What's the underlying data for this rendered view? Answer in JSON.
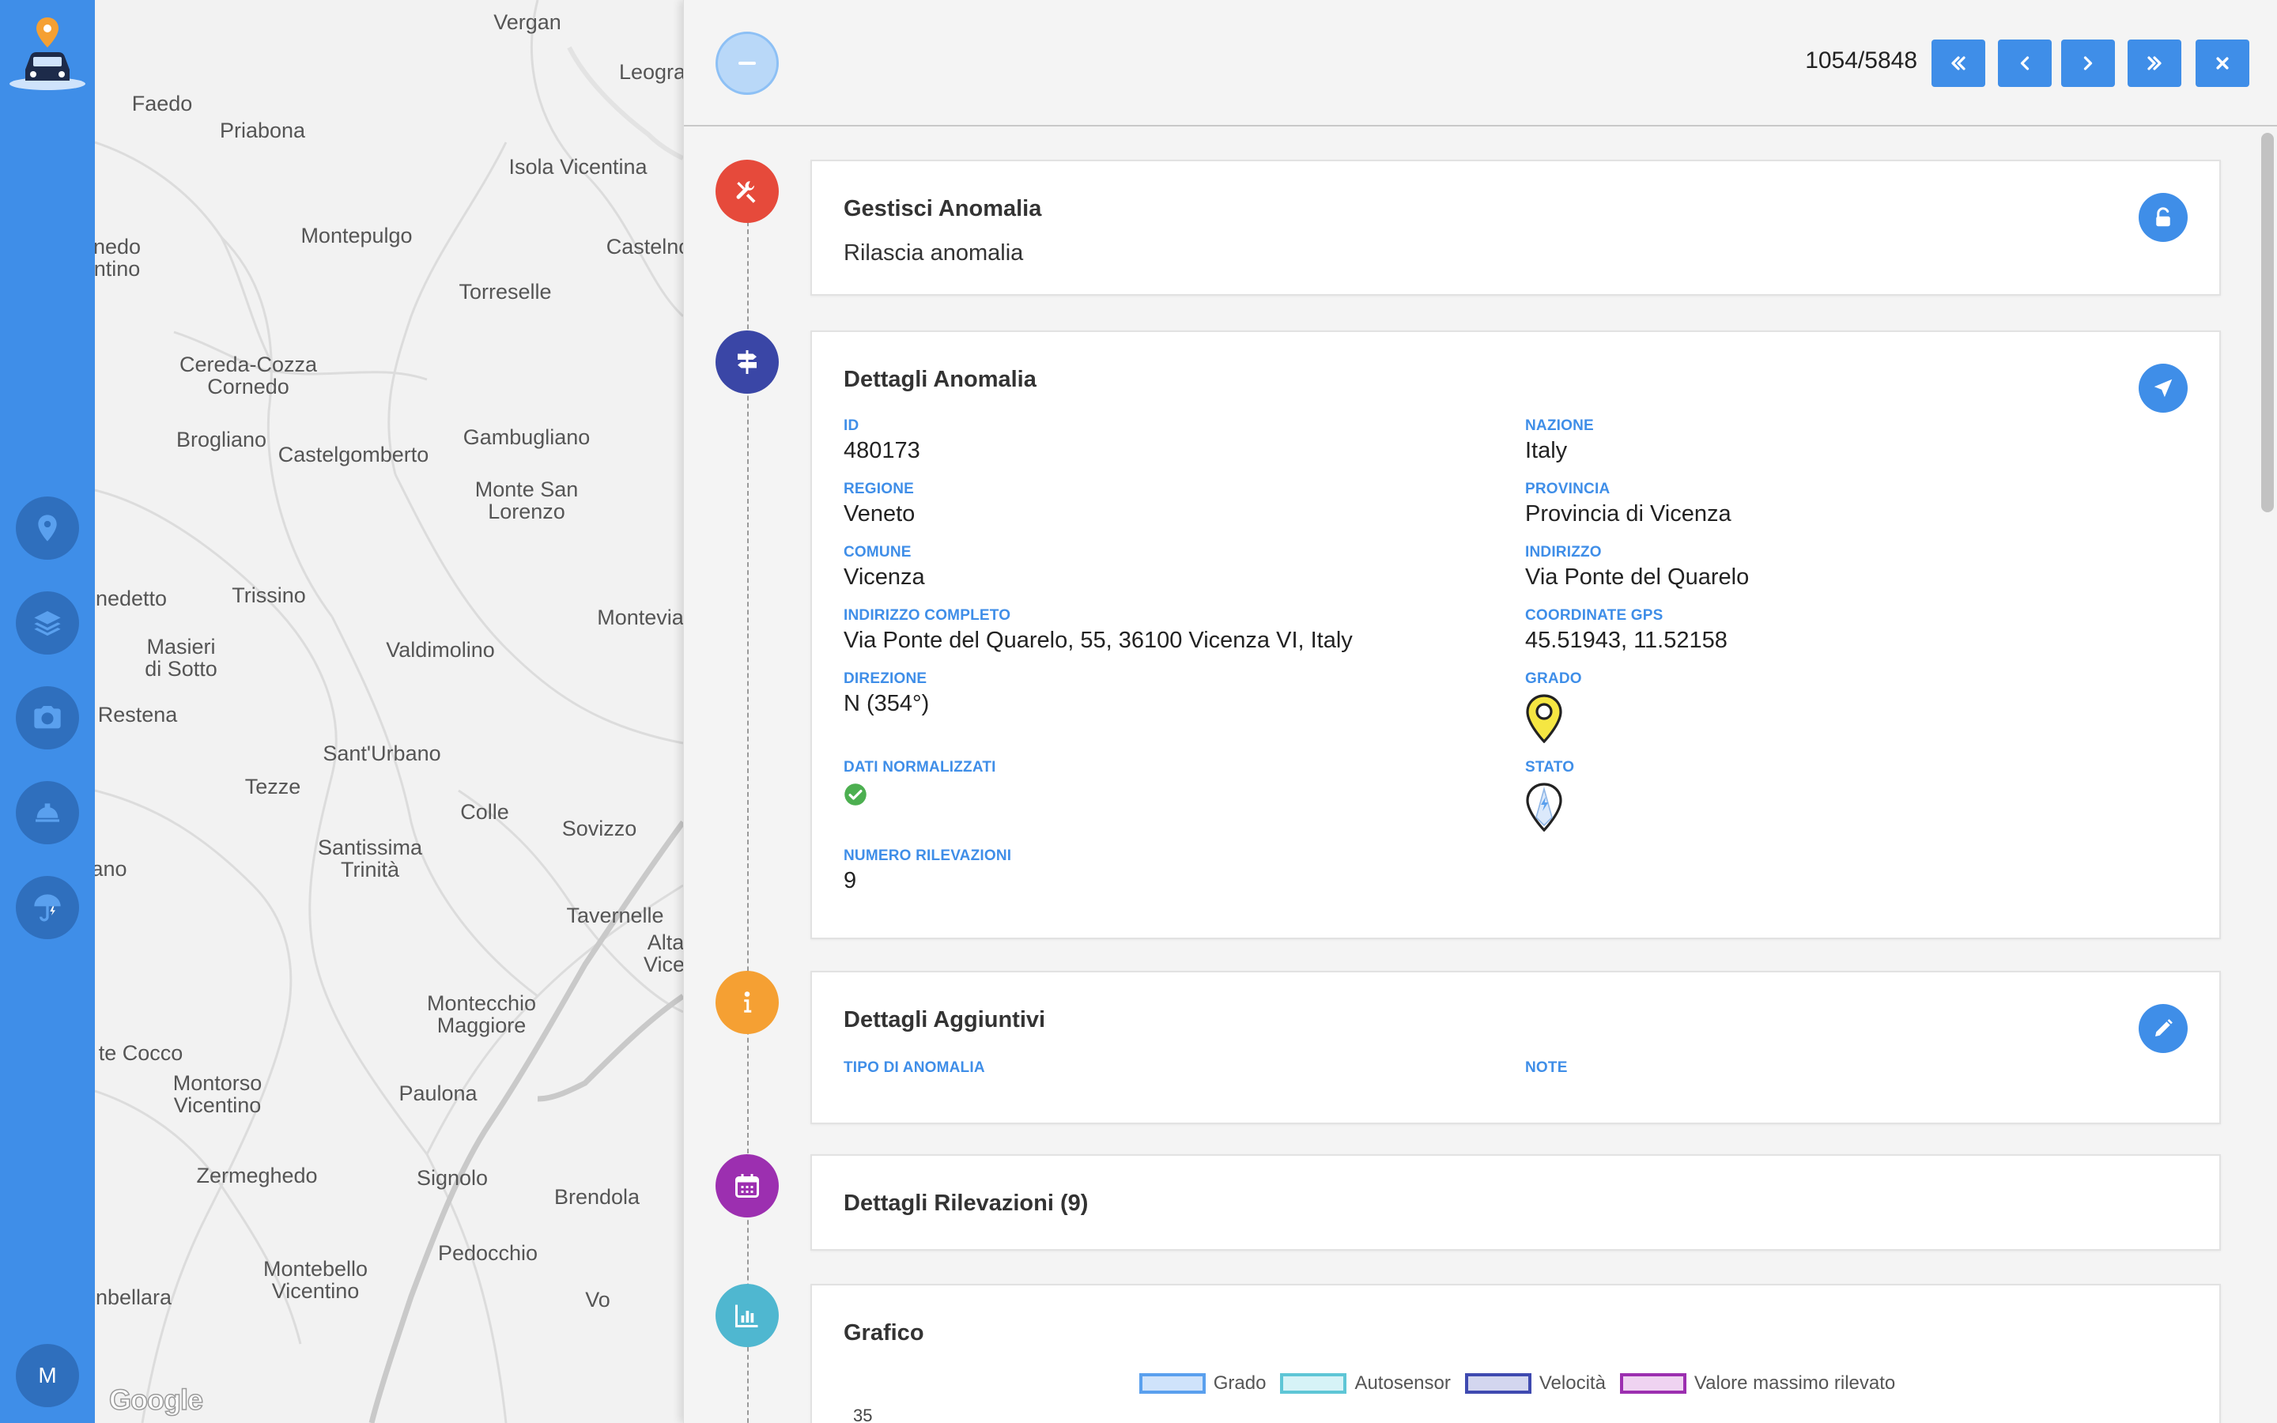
{
  "sidebar": {
    "nav": [
      {
        "name": "map-pin-icon"
      },
      {
        "name": "layers-icon"
      },
      {
        "name": "camera-icon"
      },
      {
        "name": "hard-hat-icon"
      },
      {
        "name": "umbrella-icon"
      }
    ],
    "user_initial": "M"
  },
  "map": {
    "places": [
      "Vergan",
      "Leogra",
      "Faedo",
      "Priabona",
      "Isola Vicentina",
      "nedo",
      "ntino",
      "Montepulgo",
      "Castelno",
      "Torreselle",
      "Cereda-Cozza",
      "Cornedo",
      "Brogliano",
      "Castelgomberto",
      "Gambugliano",
      "Monte San",
      "Lorenzo",
      "nedetto",
      "Trissino",
      "Montevia",
      "Masieri",
      "di Sotto",
      "Valdimolino",
      "Restena",
      "Sant'Urbano",
      "Tezze",
      "Colle",
      "Sovizzo",
      "Santissima",
      "Trinità",
      "ano",
      "Tavernelle",
      "Alta",
      "Vice",
      "Montecchio",
      "Maggiore",
      "te Cocco",
      "Montorso",
      "Vicentino",
      "Paulona",
      "Zermeghedo",
      "Signolo",
      "Brendola",
      "Pedocchio",
      "Montebello",
      "Vicentino",
      "nbellara",
      "Vo"
    ],
    "attribution": "Google"
  },
  "header": {
    "counter": "1054/5848"
  },
  "manage": {
    "title": "Gestisci Anomalia",
    "action": "Rilascia anomalia"
  },
  "details": {
    "title": "Dettagli Anomalia",
    "fields": {
      "id": {
        "label": "ID",
        "value": "480173"
      },
      "nazione": {
        "label": "NAZIONE",
        "value": "Italy"
      },
      "regione": {
        "label": "REGIONE",
        "value": "Veneto"
      },
      "provincia": {
        "label": "PROVINCIA",
        "value": "Provincia di Vicenza"
      },
      "comune": {
        "label": "COMUNE",
        "value": "Vicenza"
      },
      "indirizzo": {
        "label": "INDIRIZZO",
        "value": "Via Ponte del Quarelo"
      },
      "indirizzo_completo": {
        "label": "INDIRIZZO COMPLETO",
        "value": "Via Ponte del Quarelo, 55, 36100 Vicenza VI, Italy"
      },
      "coordinate": {
        "label": "COORDINATE GPS",
        "value": "45.51943, 11.52158"
      },
      "direzione": {
        "label": "DIREZIONE",
        "value": "N (354°)"
      },
      "grado": {
        "label": "GRADO"
      },
      "dati_normalizzati": {
        "label": "DATI NORMALIZZATI"
      },
      "stato": {
        "label": "STATO"
      },
      "numero_rilevazioni": {
        "label": "NUMERO RILEVAZIONI",
        "value": "9"
      }
    },
    "grado_color": "#f5e642",
    "ok_color": "#4caf50"
  },
  "extra": {
    "title": "Dettagli Aggiuntivi",
    "tipo_label": "TIPO DI ANOMALIA",
    "note_label": "NOTE"
  },
  "rilevazioni": {
    "title": "Dettagli Rilevazioni (9)"
  },
  "grafico": {
    "title": "Grafico",
    "legend": [
      {
        "name": "Grado",
        "fill": "#cfe3fb",
        "border": "#5aa0ee"
      },
      {
        "name": "Autosensor",
        "fill": "#d6f3f7",
        "border": "#5ec6d6"
      },
      {
        "name": "Velocità",
        "fill": "#d3d6ef",
        "border": "#3f4ab0"
      },
      {
        "name": "Valore massimo rilevato",
        "fill": "#efd3f1",
        "border": "#9c2fb0"
      }
    ],
    "y_tick": "35"
  },
  "colors": {
    "accent": "#3f8ee8",
    "manage_icon": "#e64a3b",
    "details_icon": "#3a46a6",
    "extra_icon": "#f5a033",
    "rilevazioni_icon": "#9c2fb0",
    "grafico_icon": "#4fb7d0"
  }
}
